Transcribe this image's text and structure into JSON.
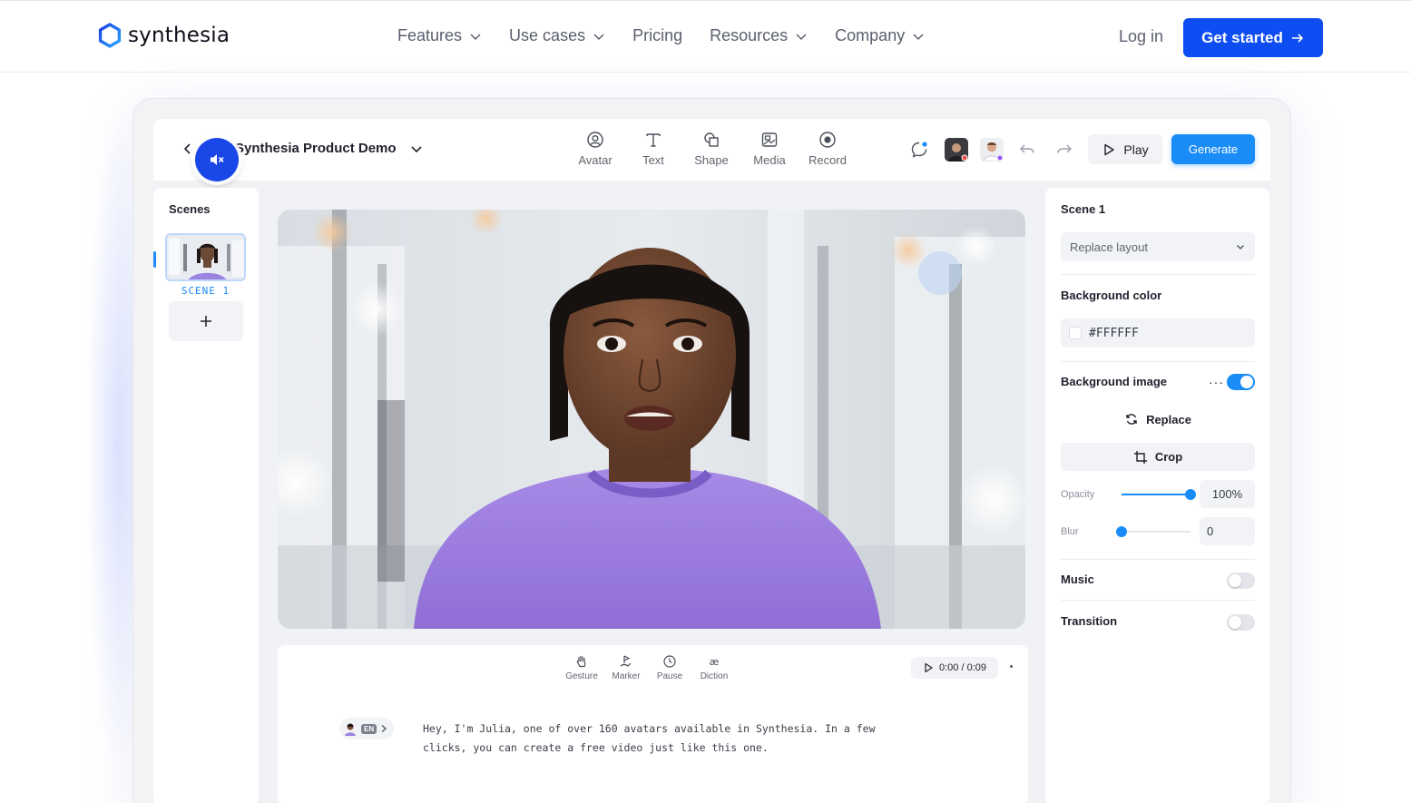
{
  "brand": {
    "name": "synthesia",
    "accent": "#0d4df2"
  },
  "nav": {
    "items": [
      {
        "label": "Features",
        "dropdown": true
      },
      {
        "label": "Use cases",
        "dropdown": true
      },
      {
        "label": "Pricing",
        "dropdown": false
      },
      {
        "label": "Resources",
        "dropdown": true
      },
      {
        "label": "Company",
        "dropdown": true
      }
    ],
    "login": "Log in",
    "cta": "Get started"
  },
  "editor": {
    "project_title": "Synthesia Product Demo",
    "tools": [
      "Avatar",
      "Text",
      "Shape",
      "Media",
      "Record"
    ],
    "play": "Play",
    "generate": "Generate",
    "generate_color": "#1a8cf7",
    "scenes": {
      "title": "Scenes",
      "items": [
        {
          "label": "SCENE 1"
        }
      ]
    },
    "script": {
      "tools": [
        "Gesture",
        "Marker",
        "Pause",
        "Diction"
      ],
      "timecode": "0:00 / 0:09",
      "language": "EN",
      "text": "Hey, I'm Julia, one of over 160 avatars available in Synthesia. In a few clicks, you can create a free video just like this one."
    },
    "properties": {
      "scene_title": "Scene 1",
      "layout_select": "Replace layout",
      "bg_color_label": "Background color",
      "bg_color_value": "#FFFFFF",
      "bg_image_label": "Background image",
      "bg_image_enabled": true,
      "replace": "Replace",
      "crop": "Crop",
      "opacity_label": "Opacity",
      "opacity_value": "100%",
      "opacity_level": 1.0,
      "blur_label": "Blur",
      "blur_value": "0",
      "blur_level": 0.0,
      "music_label": "Music",
      "music_enabled": false,
      "transition_label": "Transition",
      "transition_enabled": false
    }
  }
}
